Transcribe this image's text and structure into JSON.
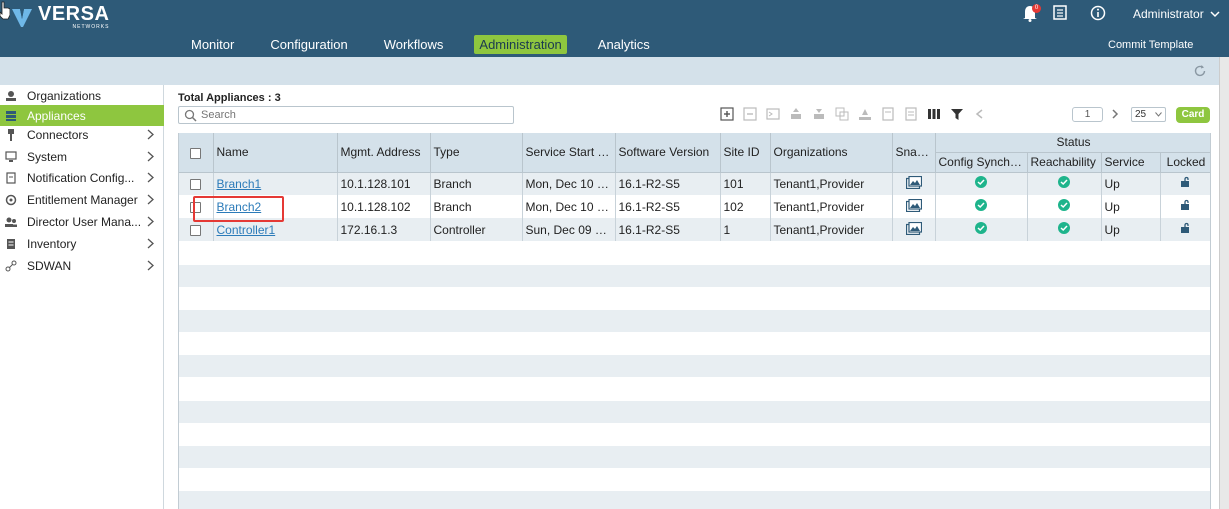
{
  "app": {
    "logo_title": "VERSA",
    "logo_subtitle": "NETWORKS",
    "notification_count": "0",
    "user": "Administrator",
    "commit_template": "Commit Template"
  },
  "nav": [
    {
      "label": "Monitor",
      "active": false
    },
    {
      "label": "Configuration",
      "active": false
    },
    {
      "label": "Workflows",
      "active": false
    },
    {
      "label": "Administration",
      "active": true
    },
    {
      "label": "Analytics",
      "active": false
    }
  ],
  "sidebar": [
    {
      "label": "Organizations",
      "icon": "organizations-icon",
      "chevron": false,
      "active": false
    },
    {
      "label": "Appliances",
      "icon": "appliances-icon",
      "chevron": false,
      "active": true
    },
    {
      "label": "Connectors",
      "icon": "connectors-icon",
      "chevron": true,
      "active": false
    },
    {
      "label": "System",
      "icon": "system-icon",
      "chevron": true,
      "active": false
    },
    {
      "label": "Notification Config...",
      "icon": "notification-config-icon",
      "chevron": true,
      "active": false
    },
    {
      "label": "Entitlement Manager",
      "icon": "entitlement-icon",
      "chevron": true,
      "active": false
    },
    {
      "label": "Director User Mana...",
      "icon": "users-icon",
      "chevron": true,
      "active": false
    },
    {
      "label": "Inventory",
      "icon": "inventory-icon",
      "chevron": true,
      "active": false
    },
    {
      "label": "SDWAN",
      "icon": "sdwan-icon",
      "chevron": true,
      "active": false
    }
  ],
  "main": {
    "total_label": "Total Appliances : ",
    "total_count": "3",
    "search_placeholder": "Search",
    "page_number": "1",
    "per_page": "25",
    "card_label": "Card"
  },
  "table": {
    "status_group": "Status",
    "columns": [
      "Name",
      "Mgmt. Address",
      "Type",
      "Service Start Ti...",
      "Software Version",
      "Site ID",
      "Organizations",
      "Snap...",
      "Config Synchro...",
      "Reachability",
      "Service",
      "Locked"
    ],
    "rows": [
      {
        "name": "Branch1",
        "mgmt": "10.1.128.101",
        "type": "Branch",
        "start": "Mon, Dec 10 20...",
        "version": "16.1-R2-S5",
        "site": "101",
        "orgs": "Tenant1,Provider",
        "service": "Up"
      },
      {
        "name": "Branch2",
        "mgmt": "10.1.128.102",
        "type": "Branch",
        "start": "Mon, Dec 10 20...",
        "version": "16.1-R2-S5",
        "site": "102",
        "orgs": "Tenant1,Provider",
        "service": "Up"
      },
      {
        "name": "Controller1",
        "mgmt": "172.16.1.3",
        "type": "Controller",
        "start": "Sun, Dec 09 20...",
        "version": "16.1-R2-S5",
        "site": "1",
        "orgs": "Tenant1,Provider",
        "service": "Up"
      }
    ]
  },
  "colors": {
    "header": "#2e5a78",
    "accent": "#8ec63f",
    "status_ok": "#1eb48c",
    "highlight": "#e53935"
  }
}
